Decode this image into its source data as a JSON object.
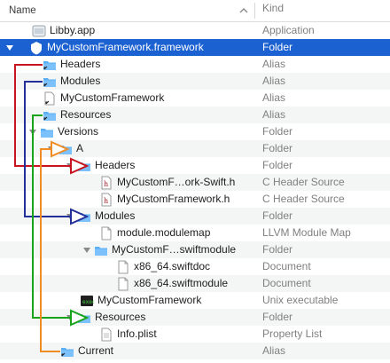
{
  "header": {
    "name_label": "Name",
    "kind_label": "Kind"
  },
  "colors": {
    "selection": "#1b61d1",
    "folder": "#5aaef5",
    "arrow_headers": "#c8141e",
    "arrow_modules": "#24309a",
    "arrow_resources": "#17a31a",
    "arrow_current": "#f08c24"
  },
  "rows": [
    {
      "name": "Libby.app",
      "kind": "Application",
      "icon": "app-icon"
    },
    {
      "name": "MyCustomFramework.framework",
      "kind": "Folder",
      "icon": "framework-folder-icon"
    },
    {
      "name": "Headers",
      "kind": "Alias",
      "icon": "folder-alias-icon"
    },
    {
      "name": "Modules",
      "kind": "Alias",
      "icon": "folder-alias-icon"
    },
    {
      "name": "MyCustomFramework",
      "kind": "Alias",
      "icon": "file-alias-icon"
    },
    {
      "name": "Resources",
      "kind": "Alias",
      "icon": "folder-alias-icon"
    },
    {
      "name": "Versions",
      "kind": "Folder",
      "icon": "folder-icon"
    },
    {
      "name": "A",
      "kind": "Folder",
      "icon": "folder-icon"
    },
    {
      "name": "Headers",
      "kind": "Folder",
      "icon": "folder-icon"
    },
    {
      "name": "MyCustomF…ork-Swift.h",
      "kind": "C Header Source",
      "icon": "header-file-icon"
    },
    {
      "name": "MyCustomFramework.h",
      "kind": "C Header Source",
      "icon": "header-file-icon"
    },
    {
      "name": "Modules",
      "kind": "Folder",
      "icon": "folder-icon"
    },
    {
      "name": "module.modulemap",
      "kind": "LLVM Module Map",
      "icon": "document-icon"
    },
    {
      "name": "MyCustomF…swiftmodule",
      "kind": "Folder",
      "icon": "folder-icon"
    },
    {
      "name": "x86_64.swiftdoc",
      "kind": "Document",
      "icon": "document-icon"
    },
    {
      "name": "x86_64.swiftmodule",
      "kind": "Document",
      "icon": "document-icon"
    },
    {
      "name": "MyCustomFramework",
      "kind": "Unix executable",
      "icon": "executable-icon"
    },
    {
      "name": "Resources",
      "kind": "Folder",
      "icon": "folder-icon"
    },
    {
      "name": "Info.plist",
      "kind": "Property List",
      "icon": "document-icon"
    },
    {
      "name": "Current",
      "kind": "Alias",
      "icon": "folder-alias-icon"
    }
  ]
}
